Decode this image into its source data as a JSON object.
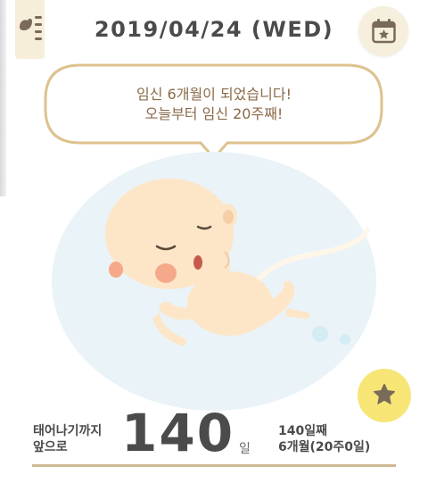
{
  "header": {
    "date": "2019/04/24 (WED)",
    "menu_icon": "menu-icon",
    "calendar_icon": "calendar-star-icon"
  },
  "bubble": {
    "line1": "임신 6개월이 되었습니다!",
    "line2": "오늘부터 임신 20주째!"
  },
  "illustration": "fetus-illustration",
  "fab_icon": "star-icon",
  "info": {
    "countdown_line1": "태어나기까지",
    "countdown_line2": "앞으로",
    "days_left": "140",
    "days_unit": "일",
    "day_count_line1": "140일째",
    "day_count_line2": "6개월(20주0일)"
  },
  "colors": {
    "bubble_border": "#ddc28e",
    "text_brown": "#8a6a48",
    "fab_yellow": "#f7e676",
    "header_circle": "#f6efdd",
    "bottom_rule": "#cdb993"
  }
}
